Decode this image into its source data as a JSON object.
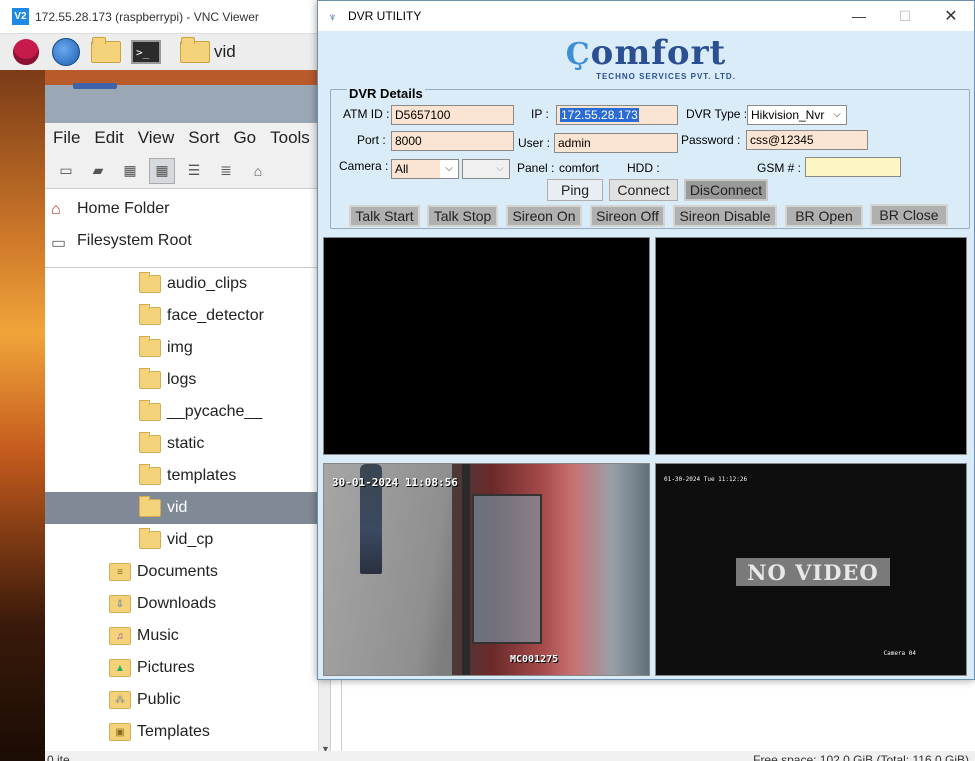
{
  "vnc": {
    "title": "172.55.28.173 (raspberrypi) - VNC Viewer",
    "logo": "V2"
  },
  "taskbar": {
    "icons": [
      "raspberry-icon",
      "globe-icon",
      "folder-icon",
      "terminal-icon"
    ],
    "terminal_glyph": ">_",
    "app_label": "vid"
  },
  "file_manager": {
    "menu": [
      "File",
      "Edit",
      "View",
      "Sort",
      "Go",
      "Tools"
    ],
    "places": [
      {
        "label": "Home Folder",
        "icon": "home-icon"
      },
      {
        "label": "Filesystem Root",
        "icon": "drive-icon"
      }
    ],
    "tree": [
      {
        "label": "audio_clips",
        "indent": 2
      },
      {
        "label": "face_detector",
        "indent": 2
      },
      {
        "label": "img",
        "indent": 2
      },
      {
        "label": "logs",
        "indent": 2
      },
      {
        "label": "__pycache__",
        "indent": 2
      },
      {
        "label": "static",
        "indent": 2
      },
      {
        "label": "templates",
        "indent": 2
      },
      {
        "label": "vid",
        "indent": 2,
        "selected": true
      },
      {
        "label": "vid_cp",
        "indent": 2
      },
      {
        "label": "Documents",
        "indent": 1
      },
      {
        "label": "Downloads",
        "indent": 1
      },
      {
        "label": "Music",
        "indent": 1
      },
      {
        "label": "Pictures",
        "indent": 1
      },
      {
        "label": "Public",
        "indent": 1
      },
      {
        "label": "Templates",
        "indent": 1
      }
    ],
    "status_left": "0 ite",
    "status_right": "Free space: 102.0 GiB (Total: 116.0 GiB)"
  },
  "dvr": {
    "title": "DVR UTILITY",
    "logo": {
      "main": "omfort",
      "sub": "TECHNO SERVICES PVT. LTD."
    },
    "section_title": "DVR Details",
    "atm_id_label": "ATM ID :",
    "atm_id": "D5657100",
    "ip_label": "IP :",
    "ip": "172.55.28.173",
    "dvr_type_label": "DVR Type :",
    "dvr_type": "Hikvision_Nvr",
    "port_label": "Port :",
    "port": "8000",
    "user_label": "User :",
    "user": "admin",
    "password_label": "Password :",
    "password": "css@12345",
    "camera_label": "Camera :",
    "camera": "All",
    "panel_label": "Panel :",
    "panel": "comfort",
    "hdd_label": "HDD :",
    "gsm_label": "GSM # :",
    "buttons": {
      "ping": "Ping",
      "connect": "Connect",
      "disconnect": "DisConnect",
      "talk_start": "Talk Start",
      "talk_stop": "Talk Stop",
      "sireon_on": "Sireon On",
      "sireon_off": "Sireon Off",
      "sireon_disable": "Sireon Disable",
      "br_open": "BR Open",
      "br_close": "BR Close"
    },
    "cameras": {
      "cam3_timestamp": "30-01-2024 11:08:56",
      "cam3_id": "MC001275",
      "cam4_timestamp": "01-30-2024 Tue 11:12:26",
      "cam4_message": "NO VIDEO",
      "cam4_label": "Camera 04"
    }
  }
}
